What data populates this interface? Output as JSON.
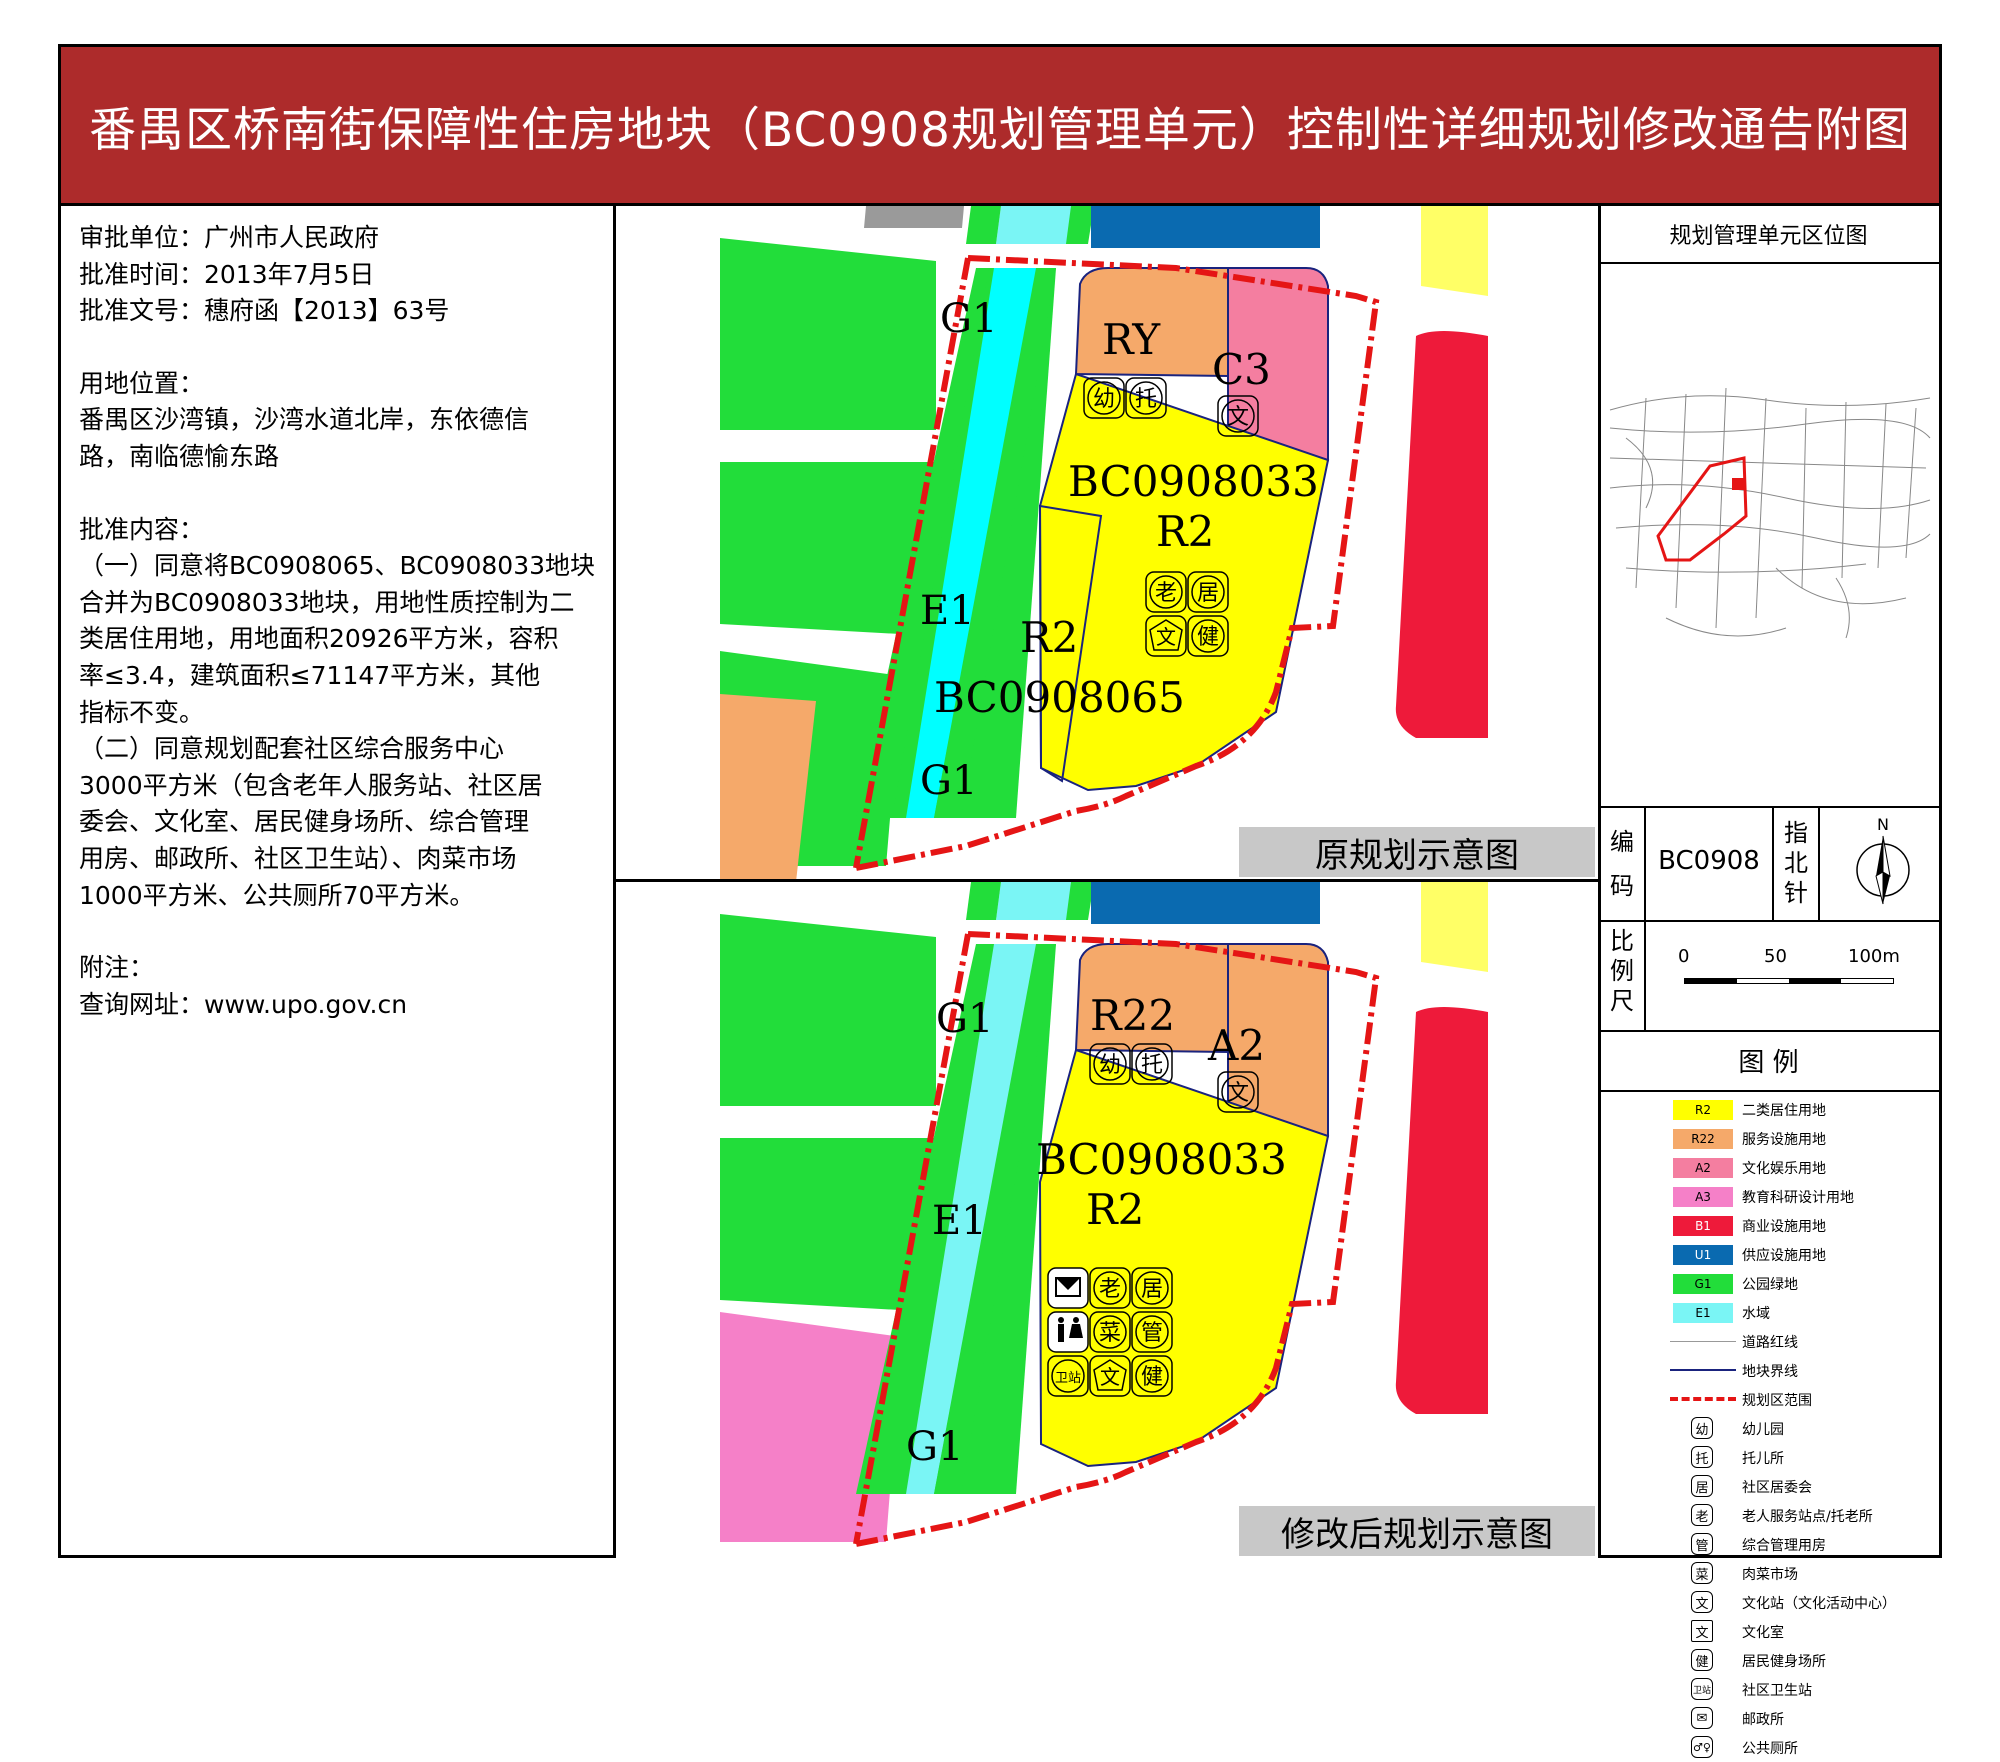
{
  "title": "番禺区桥南街保障性住房地块（BC0908规划管理单元）控制性详细规划修改通告附图",
  "info": {
    "approval_unit": "审批单位：广州市人民政府",
    "approval_date": "批准时间：2013年7月5日",
    "approval_doc": "批准文号：穗府函【2013】63号",
    "location_label": "用地位置：",
    "location_lines": [
      "番禺区沙湾镇，沙湾水道北岸，东依德信",
      "路，南临德愉东路"
    ],
    "content_label": "批准内容：",
    "content_lines": [
      "（一）同意将BC0908065、BC0908033地块",
      "合并为BC0908033地块，用地性质控制为二",
      "类居住用地，用地面积20926平方米，容积",
      "率≤3.4，建筑面积≤71147平方米，其他",
      "指标不变。",
      "（二）同意规划配套社区综合服务中心",
      "3000平方米（包含老年人服务站、社区居",
      "委会、文化室、居民健身场所、综合管理",
      "用房、邮政所、社区卫生站）、肉菜市场",
      "1000平方米、公共厕所70平方米。"
    ],
    "note_label": "附注：",
    "query_url": "查询网址：www.upo.gov.cn"
  },
  "original_map": {
    "caption": "原规划示意图",
    "labels": {
      "g1_top": "G1",
      "g1_bottom": "G1",
      "e1": "E1",
      "ry": "RY",
      "c3": "C3",
      "parcel_033": "BC0908033",
      "r2_033": "R2",
      "r2_065": "R2",
      "parcel_065": "BC0908065"
    },
    "icons": {
      "you": "幼",
      "tuo": "托",
      "wen": "文",
      "lao": "老",
      "ju": "居",
      "wen_room": "文",
      "jian": "健"
    }
  },
  "revised_map": {
    "caption": "修改后规划示意图",
    "labels": {
      "g1_top": "G1",
      "g1_bottom": "G1",
      "e1": "E1",
      "r22": "R22",
      "a2": "A2",
      "parcel_033": "BC0908033",
      "r2": "R2"
    },
    "icons": {
      "you": "幼",
      "tuo": "托",
      "wen": "文",
      "lao": "老",
      "ju": "居",
      "cai": "菜",
      "guan": "管",
      "weizhan": "卫站",
      "wen_room": "文",
      "jian": "健"
    }
  },
  "right": {
    "location_title": "规划管理单元区位图",
    "code_label": "编码",
    "code_value": "BC0908",
    "north_label": "指北针",
    "north_letter": "N",
    "scale_label": "比例尺",
    "scale_ticks": [
      "0",
      "50",
      "100m"
    ],
    "legend_title": "图  例",
    "legend": [
      {
        "code": "R2",
        "text": "二类居住用地",
        "color": "#ffff00",
        "kind": "swatch"
      },
      {
        "code": "R22",
        "text": "服务设施用地",
        "color": "#f5a96a",
        "kind": "swatch"
      },
      {
        "code": "A2",
        "text": "文化娱乐用地",
        "color": "#f47ea0",
        "kind": "swatch"
      },
      {
        "code": "A3",
        "text": "教育科研设计用地",
        "color": "#f580c8",
        "kind": "swatch"
      },
      {
        "code": "B1",
        "text": "商业设施用地",
        "color": "#ee1a3a",
        "kind": "swatch"
      },
      {
        "code": "U1",
        "text": "供应设施用地",
        "color": "#0a6ab0",
        "kind": "swatch"
      },
      {
        "code": "G1",
        "text": "公园绿地",
        "color": "#22dd3a",
        "kind": "swatch"
      },
      {
        "code": "E1",
        "text": "水域",
        "color": "#7af5f5",
        "kind": "swatch"
      },
      {
        "code": "",
        "text": "道路红线",
        "color": "#999999",
        "kind": "line-thin"
      },
      {
        "code": "",
        "text": "地块界线",
        "color": "#1a237e",
        "kind": "line-blue"
      },
      {
        "code": "",
        "text": "规划区范围",
        "color": "#e51515",
        "kind": "line-red"
      },
      {
        "code": "幼",
        "text": "幼儿园",
        "kind": "icon"
      },
      {
        "code": "托",
        "text": "托儿所",
        "kind": "icon"
      },
      {
        "code": "居",
        "text": "社区居委会",
        "kind": "icon"
      },
      {
        "code": "老",
        "text": "老人服务站点/托老所",
        "kind": "icon"
      },
      {
        "code": "管",
        "text": "综合管理用房",
        "kind": "icon"
      },
      {
        "code": "菜",
        "text": "肉菜市场",
        "kind": "icon"
      },
      {
        "code": "文",
        "text": "文化站（文化活动中心）",
        "kind": "icon"
      },
      {
        "code": "文",
        "text": "文化室",
        "kind": "icon"
      },
      {
        "code": "健",
        "text": "居民健身场所",
        "kind": "icon"
      },
      {
        "code": "卫站",
        "text": "社区卫生站",
        "kind": "icon"
      },
      {
        "code": "✉",
        "text": "邮政所",
        "kind": "icon"
      },
      {
        "code": "♂♀",
        "text": "公共厕所",
        "kind": "icon"
      }
    ]
  }
}
